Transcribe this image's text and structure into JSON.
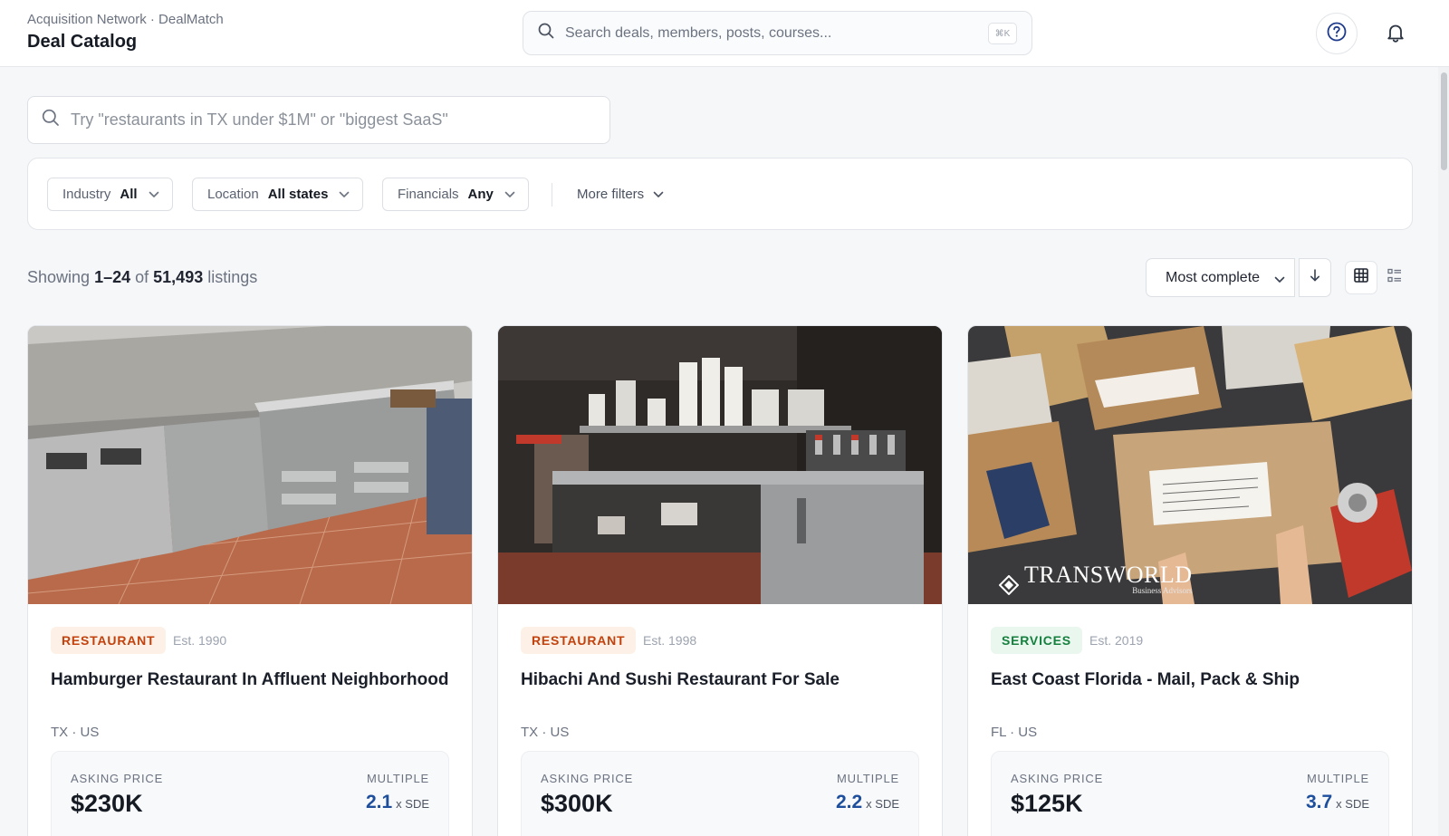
{
  "header": {
    "breadcrumb": "Acquisition Network · DealMatch",
    "title": "Deal Catalog",
    "search_placeholder": "Search deals, members, posts, courses...",
    "shortcut": "⌘K",
    "help_icon": "question-circle-icon",
    "notifications_icon": "bell-icon"
  },
  "nl_search": {
    "placeholder": "Try \"restaurants in TX under $1M\" or \"biggest SaaS\""
  },
  "filters": {
    "industry": {
      "label": "Industry",
      "value": "All"
    },
    "location": {
      "label": "Location",
      "value": "All states"
    },
    "financials": {
      "label": "Financials",
      "value": "Any"
    },
    "more": "More filters"
  },
  "results": {
    "prefix": "Showing",
    "range": "1–24",
    "of": "of",
    "total": "51,493",
    "suffix": "listings",
    "sort": "Most complete"
  },
  "listings": [
    {
      "category": "RESTAURANT",
      "est": "Est. 1990",
      "title": "Hamburger Restaurant In Affluent Neighborhood",
      "location": "TX · US",
      "asking_label": "ASKING PRICE",
      "asking_price": "$230K",
      "multiple_label": "MULTIPLE",
      "multiple": "2.1",
      "multiple_unit": "x SDE"
    },
    {
      "category": "RESTAURANT",
      "est": "Est. 1998",
      "title": "Hibachi And Sushi Restaurant For Sale",
      "location": "TX · US",
      "asking_label": "ASKING PRICE",
      "asking_price": "$300K",
      "multiple_label": "MULTIPLE",
      "multiple": "2.2",
      "multiple_unit": "x SDE"
    },
    {
      "category": "SERVICES",
      "est": "Est. 2019",
      "title": "East Coast Florida - Mail, Pack & Ship",
      "location": "FL · US",
      "asking_label": "ASKING PRICE",
      "asking_price": "$125K",
      "multiple_label": "MULTIPLE",
      "multiple": "3.7",
      "multiple_unit": "x SDE",
      "image_watermark": "TRANSWORLD",
      "image_watermark_sub": "Business Advisors"
    }
  ],
  "colors": {
    "accent_blue": "#1e4f9c",
    "restaurant_badge": "#c2410c",
    "services_badge": "#15803d"
  }
}
